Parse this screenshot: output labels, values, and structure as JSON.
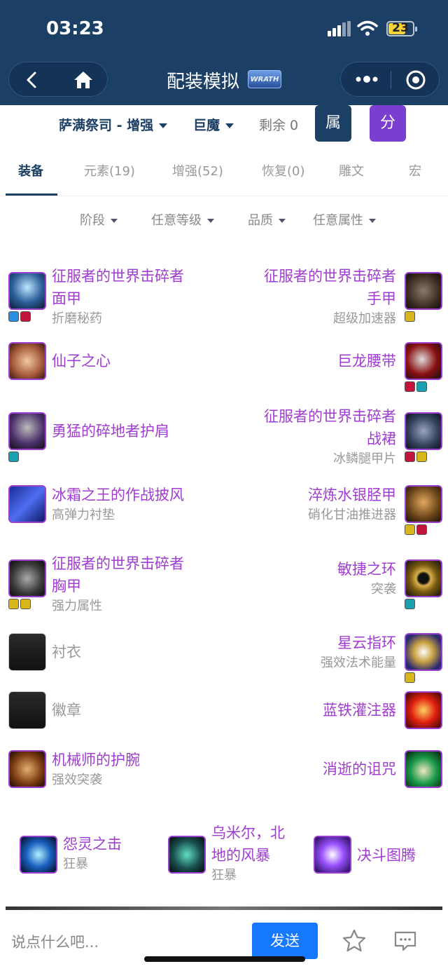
{
  "status": {
    "time": "03:23",
    "battery": "23"
  },
  "nav": {
    "title": "配装模拟",
    "logo_text": "WRATH"
  },
  "filterbar": {
    "class_spec": "萨满祭司 - 增强",
    "race": "巨魔",
    "remaining": "剩余 0",
    "attr_btn": "属",
    "score_btn": "分",
    "attr_color": "#1c3f66",
    "score_color": "#7a3fd0"
  },
  "tabs": [
    "装备",
    "元素(19)",
    "增强(52)",
    "恢复(0)",
    "雕文",
    "宏"
  ],
  "subfilters": [
    "阶段",
    "任意等级",
    "品质",
    "任意属性"
  ],
  "left_items": [
    {
      "name": "征服者的世界击碎者面甲",
      "name_lines": [
        "征服者的世界击碎者",
        "面甲"
      ],
      "sub": "折磨秘药",
      "icon": "helmet-icon",
      "gems": [
        "#2a8fe0",
        "#c4143c"
      ]
    },
    {
      "name": "仙子之心",
      "name_lines": [
        "仙子之心"
      ],
      "sub": "",
      "icon": "necklace-icon",
      "gems": []
    },
    {
      "name": "勇猛的碎地者护肩",
      "name_lines": [
        "勇猛的碎地者护肩"
      ],
      "sub": "",
      "icon": "shoulder-icon",
      "gems": [
        "#18a0b0"
      ]
    },
    {
      "name": "冰霜之王的作战披风",
      "name_lines": [
        "冰霜之王的作战披风"
      ],
      "sub": "高弹力衬垫",
      "icon": "cloak-icon",
      "gems": []
    },
    {
      "name": "征服者的世界击碎者胸甲",
      "name_lines": [
        "征服者的世界击碎者",
        "胸甲"
      ],
      "sub": "强力属性",
      "icon": "chest-icon",
      "gems": [
        "#d8b818",
        "#d8b818"
      ]
    },
    {
      "name": "衬衣",
      "name_lines": [
        "衬衣"
      ],
      "sub": "",
      "icon": "shirt-icon",
      "gems": [],
      "empty": true
    },
    {
      "name": "徽章",
      "name_lines": [
        "徽章"
      ],
      "sub": "",
      "icon": "tabard-icon",
      "gems": [],
      "empty": true
    },
    {
      "name": "机械师的护腕",
      "name_lines": [
        "机械师的护腕"
      ],
      "sub": "强效突袭",
      "icon": "bracer-icon",
      "gems": []
    }
  ],
  "right_items": [
    {
      "name": "征服者的世界击碎者手甲",
      "name_lines": [
        "征服者的世界击碎者",
        "手甲"
      ],
      "sub": "超级加速器",
      "icon": "gloves-icon",
      "gems": [
        "#d8b818"
      ]
    },
    {
      "name": "巨龙腰带",
      "name_lines": [
        "巨龙腰带"
      ],
      "sub": "",
      "icon": "belt-icon",
      "gems": [
        "#c4143c",
        "#18a0b0"
      ]
    },
    {
      "name": "征服者的世界击碎者战裙",
      "name_lines": [
        "征服者的世界击碎者",
        "战裙"
      ],
      "sub": "冰鳞腿甲片",
      "icon": "legs-icon",
      "gems": [
        "#c4143c",
        "#d8b818"
      ]
    },
    {
      "name": "淬炼水银胫甲",
      "name_lines": [
        "淬炼水银胫甲"
      ],
      "sub": "硝化甘油推进器",
      "icon": "boots-icon",
      "gems": [
        "#d8b818",
        "#c4143c"
      ]
    },
    {
      "name": "敏捷之环",
      "name_lines": [
        "敏捷之环"
      ],
      "sub": "突袭",
      "icon": "ring-icon",
      "gems": [
        "#18a0b0"
      ]
    },
    {
      "name": "星云指环",
      "name_lines": [
        "星云指环"
      ],
      "sub": "强效法术能量",
      "icon": "ring2-icon",
      "gems": [
        "#d8b818"
      ]
    },
    {
      "name": "蓝铁灌注器",
      "name_lines": [
        "蓝铁灌注器"
      ],
      "sub": "",
      "icon": "trinket-icon",
      "gems": []
    },
    {
      "name": "消逝的诅咒",
      "name_lines": [
        "消逝的诅咒"
      ],
      "sub": "",
      "icon": "trinket2-icon",
      "gems": []
    }
  ],
  "weapons": [
    {
      "name": "怨灵之击",
      "name_lines": [
        "怨灵之击"
      ],
      "sub": "狂暴",
      "icon": "mainhand-icon"
    },
    {
      "name": "乌米尔，北地的风暴",
      "name_lines": [
        "乌米尔，北",
        "地的风暴"
      ],
      "sub": "狂暴",
      "icon": "offhand-icon"
    },
    {
      "name": "决斗图腾",
      "name_lines": [
        "决斗图腾"
      ],
      "sub": "",
      "icon": "totem-icon"
    }
  ],
  "bottom": {
    "placeholder": "说点什么吧...",
    "send": "发送"
  }
}
